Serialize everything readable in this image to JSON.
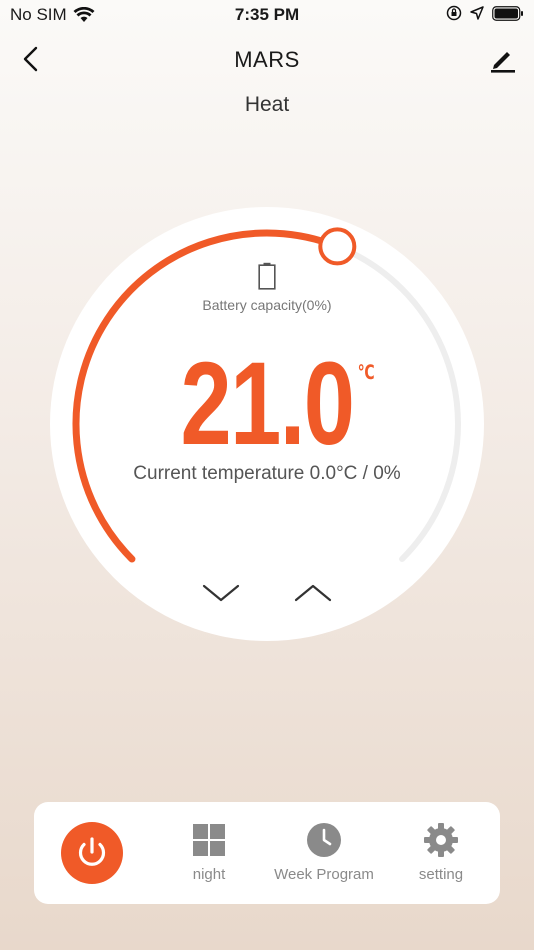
{
  "status": {
    "carrier": "No SIM",
    "time": "7:35 PM"
  },
  "header": {
    "title": "MARS",
    "mode": "Heat"
  },
  "dial": {
    "battery_text": "Battery capacity(0%)",
    "set_temperature": "21.0",
    "unit": "℃",
    "current_text": "Current temperature 0.0°C / 0%",
    "level_fraction": 0.58
  },
  "bottom_bar": {
    "night_label": "night",
    "week_program_label": "Week Program",
    "setting_label": "setting"
  },
  "colors": {
    "accent": "#f05a28",
    "track": "#eeeeee",
    "icon_gray": "#8a8a8a"
  }
}
